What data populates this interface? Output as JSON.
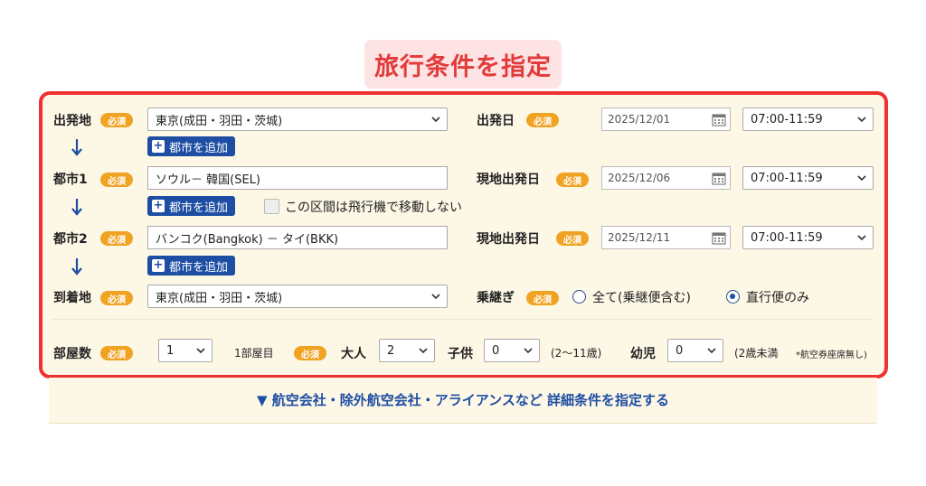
{
  "heading": "旅行条件を指定",
  "required": "必須",
  "add_city": "都市を追加",
  "rows": {
    "departure": {
      "label": "出発地",
      "value": "東京(成田・羽田・茨城)"
    },
    "city1": {
      "label": "都市1",
      "value": "ソウル－ 韓国(SEL)"
    },
    "city2": {
      "label": "都市2",
      "value": "バンコク(Bangkok) － タイ(BKK)"
    },
    "arrival": {
      "label": "到着地",
      "value": "東京(成田・羽田・茨城)"
    }
  },
  "no_flight_checkbox": "この区間は飛行機で移動しない",
  "dates": [
    {
      "label": "出発日",
      "date": "2025/12/01",
      "time": "07:00-11:59"
    },
    {
      "label": "現地出発日",
      "date": "2025/12/06",
      "time": "07:00-11:59"
    },
    {
      "label": "現地出発日",
      "date": "2025/12/11",
      "time": "07:00-11:59"
    }
  ],
  "transfer": {
    "label": "乗継ぎ",
    "options": [
      "全て(乗継便含む)",
      "直行便のみ"
    ],
    "selected": "直行便のみ"
  },
  "rooms": {
    "label": "部屋数",
    "count": "1",
    "room_label": "1部屋目",
    "adult_label": "大人",
    "adult_value": "2",
    "child_label": "子供",
    "child_value": "0",
    "child_note": "(2〜11歳)",
    "infant_label": "幼児",
    "infant_value": "0",
    "infant_note": "(2歳未満",
    "infant_note2": "*航空券座席無し)"
  },
  "detail_link": "▼ 航空会社・除外航空会社・アライアンスなど 詳細条件を指定する",
  "colors": {
    "accent_red": "#ee3131",
    "button_blue": "#1e4ea3",
    "badge_orange": "#f0a323",
    "panel_bg": "#fdf7e6"
  }
}
